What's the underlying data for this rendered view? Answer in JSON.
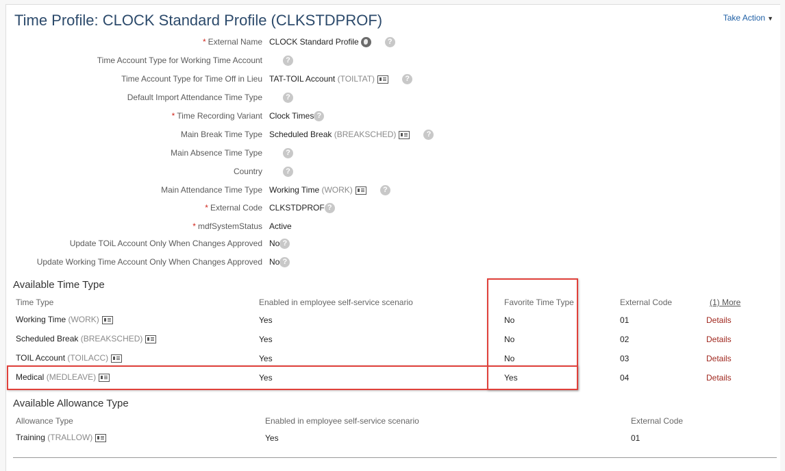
{
  "header": {
    "title": "Time Profile: CLOCK Standard Profile (CLKSTDPROF)",
    "take_action": "Take Action"
  },
  "fields": [
    {
      "label": "External Name",
      "required": true,
      "value": "CLOCK Standard Profile",
      "code": ""
    },
    {
      "label": "Time Account Type for Working Time Account",
      "required": false,
      "value": "",
      "code": ""
    },
    {
      "label": "Time Account Type for Time Off in Lieu",
      "required": false,
      "value": "TAT-TOIL Account",
      "code": "(TOILTAT)"
    },
    {
      "label": "Default Import Attendance Time Type",
      "required": false,
      "value": "",
      "code": ""
    },
    {
      "label": "Time Recording Variant",
      "required": true,
      "value": "Clock Times",
      "code": ""
    },
    {
      "label": "Main Break Time Type",
      "required": false,
      "value": "Scheduled Break",
      "code": "(BREAKSCHED)"
    },
    {
      "label": "Main Absence Time Type",
      "required": false,
      "value": "",
      "code": ""
    },
    {
      "label": "Country",
      "required": false,
      "value": "",
      "code": ""
    },
    {
      "label": "Main Attendance Time Type",
      "required": false,
      "value": "Working Time",
      "code": "(WORK)"
    },
    {
      "label": "External Code",
      "required": true,
      "value": "CLKSTDPROF",
      "code": ""
    },
    {
      "label": "mdfSystemStatus",
      "required": true,
      "value": "Active",
      "code": ""
    },
    {
      "label": "Update TOiL Account Only When Changes Approved",
      "required": false,
      "value": "No",
      "code": ""
    },
    {
      "label": "Update Working Time Account Only When Changes Approved",
      "required": false,
      "value": "No",
      "code": ""
    }
  ],
  "help_glyph": "?",
  "required_mark": "*",
  "time_types": {
    "title": "Available Time Type",
    "headers": {
      "type": "Time Type",
      "ess": "Enabled in employee self-service scenario",
      "favorite": "Favorite Time Type",
      "code": "External Code",
      "more": "(1) More"
    },
    "rows": [
      {
        "name": "Working Time",
        "code": "(WORK)",
        "ess": "Yes",
        "favorite": "No",
        "external": "01",
        "details": "Details"
      },
      {
        "name": "Scheduled Break",
        "code": "(BREAKSCHED)",
        "ess": "Yes",
        "favorite": "No",
        "external": "02",
        "details": "Details"
      },
      {
        "name": "TOIL Account",
        "code": "(TOILACC)",
        "ess": "Yes",
        "favorite": "No",
        "external": "03",
        "details": "Details"
      },
      {
        "name": "Medical",
        "code": "(MEDLEAVE)",
        "ess": "Yes",
        "favorite": "Yes",
        "external": "04",
        "details": "Details"
      }
    ]
  },
  "allowance_types": {
    "title": "Available Allowance Type",
    "headers": {
      "type": "Allowance Type",
      "ess": "Enabled in employee self-service scenario",
      "code": "External Code"
    },
    "rows": [
      {
        "name": "Training",
        "code": "(TRALLOW)",
        "ess": "Yes",
        "external": "01"
      }
    ]
  }
}
